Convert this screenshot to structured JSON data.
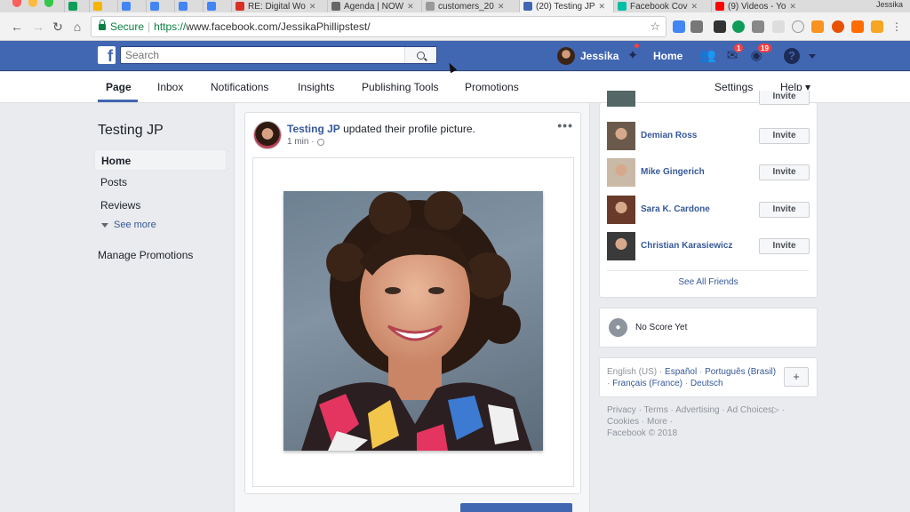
{
  "browser": {
    "tabs": [
      {
        "label": "",
        "color": "#0f9d58"
      },
      {
        "label": "",
        "color": "#f4b400"
      },
      {
        "label": "",
        "color": "#4285f4"
      },
      {
        "label": "",
        "color": "#4285f4"
      },
      {
        "label": "",
        "color": "#4285f4"
      },
      {
        "label": "",
        "color": "#4285f4"
      },
      {
        "label": "RE: Digital Wo",
        "color": "#d93025"
      },
      {
        "label": "Agenda | NOW",
        "color": "#666666"
      },
      {
        "label": "customers_20",
        "color": "#999999"
      },
      {
        "label": "(20) Testing JP",
        "color": "#4267b2"
      },
      {
        "label": "Facebook Cov",
        "color": "#00bfa5"
      },
      {
        "label": "(9) Videos - Yo",
        "color": "#ff0000"
      }
    ],
    "profile_name": "Jessika",
    "secure_label": "Secure",
    "url_scheme": "https://",
    "url_rest": "www.facebook.com/JessikaPhillipstest/"
  },
  "fb": {
    "search_placeholder": "Search",
    "user_name": "Jessika",
    "home_label": "Home",
    "friend_badge": "",
    "messages_badge": "1",
    "notifications_badge": "19",
    "help_label": "?"
  },
  "pagenav": {
    "items": [
      "Page",
      "Inbox",
      "Notifications",
      "Insights",
      "Publishing Tools",
      "Promotions"
    ],
    "settings": "Settings",
    "help": "Help ▾"
  },
  "left": {
    "page_name": "Testing JP",
    "nav": [
      "Home",
      "Posts",
      "Reviews"
    ],
    "see_more": "See more",
    "manage_promotions": "Manage Promotions"
  },
  "post": {
    "author": "Testing JP",
    "action": " updated their profile picture.",
    "time": "1 min ·",
    "menu": "•••"
  },
  "friends": [
    {
      "name": "Demian Ross",
      "invite": "Invite",
      "color": "#6b5a4c"
    },
    {
      "name": "Mike Gingerich",
      "invite": "Invite",
      "color": "#c9b9a7"
    },
    {
      "name": "Sara K. Cardone",
      "invite": "Invite",
      "color": "#6a3b2a"
    },
    {
      "name": "Christian Karasiewicz",
      "invite": "Invite",
      "color": "#3a3a3a"
    }
  ],
  "partial_invite": "Invite",
  "see_all_friends": "See All Friends",
  "score": {
    "label": "No Score Yet"
  },
  "languages": {
    "current": "English (US)",
    "others": [
      "Español",
      "Português (Brasil)",
      "Français (France)",
      "Deutsch"
    ],
    "add": "+"
  },
  "footer": {
    "links": [
      "Privacy",
      "Terms",
      "Advertising",
      "Ad Choices",
      "Cookies",
      "More"
    ],
    "copyright": "Facebook © 2018"
  }
}
